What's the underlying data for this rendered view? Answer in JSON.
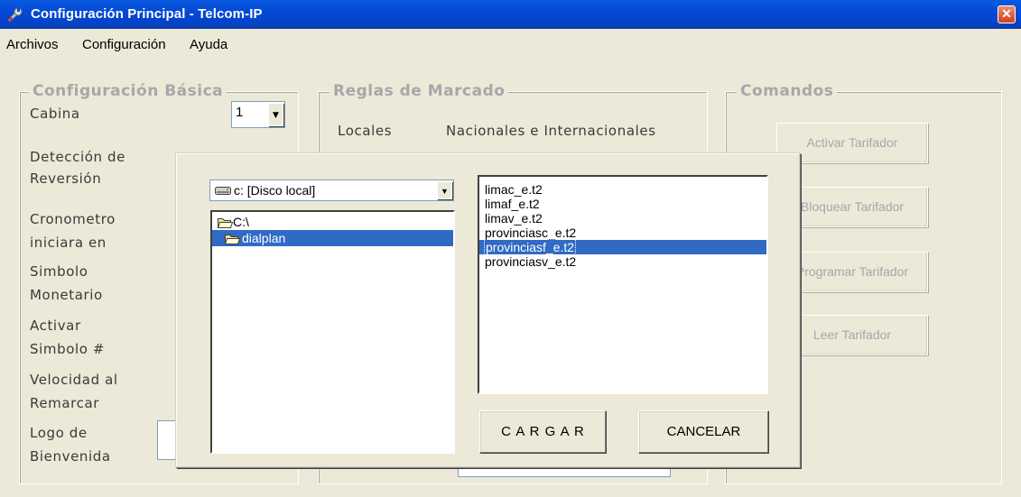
{
  "window": {
    "title": "Configuración Principal - Telcom-IP"
  },
  "menu": [
    "Archivos",
    "Configuración",
    "Ayuda"
  ],
  "config_basica": {
    "label": "Configuración Básica",
    "cabina_label": "Cabina",
    "cabina_value": "1",
    "fields": [
      {
        "line1": "Detección de",
        "line2": "Reversión"
      },
      {
        "line1": "Cronometro",
        "line2": "iniciara en"
      },
      {
        "line1": "Simbolo",
        "line2": "Monetario"
      },
      {
        "line1": "Activar",
        "line2": "Simbolo #"
      },
      {
        "line1": "Velocidad al",
        "line2": "Remarcar"
      },
      {
        "line1": "Logo de",
        "line2": "Bienvenida"
      }
    ]
  },
  "reglas": {
    "label": "Reglas de Marcado",
    "col_locales": "Locales",
    "col_nacionales": "Nacionales e Internacionales"
  },
  "comandos": {
    "label": "Comandos",
    "buttons": [
      "Activar Tarifador",
      "Bloquear Tarifador",
      "Programar Tarifador",
      "Leer Tarifador"
    ]
  },
  "file_dialog": {
    "drive": "c: [Disco local]",
    "dirs": [
      {
        "name": "C:\\",
        "selected": false
      },
      {
        "name": "dialplan",
        "selected": true
      }
    ],
    "files": [
      "limac_e.t2",
      "limaf_e.t2",
      "limav_e.t2",
      "provinciasc_e.t2",
      "provinciasf_e.t2",
      "provinciasv_e.t2"
    ],
    "selected_file_index": 4,
    "load_label": "C A R G A R",
    "cancel_label": "CANCELAR"
  },
  "colors": {
    "titlebar": "#0449d6",
    "selection": "#316ac5",
    "face": "#ece9d8",
    "disabled_text": "#a7a6aa"
  },
  "icons": [
    "wrench-app-icon",
    "close-icon",
    "chevron-down-icon",
    "drive-icon",
    "open-folder-icon"
  ]
}
